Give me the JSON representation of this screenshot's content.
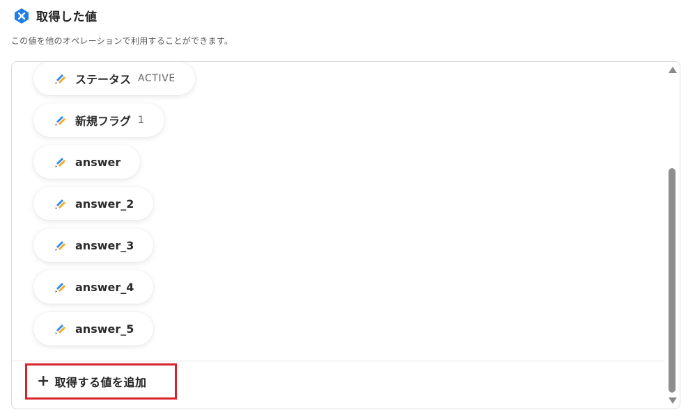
{
  "header": {
    "title": "取得した値",
    "subtitle": "この値を他のオペレーションで利用することができます。",
    "logo_icon": "x-hexagon-icon"
  },
  "fields": [
    {
      "label": "ステータス",
      "value": "ACTIVE",
      "icon": "pencil-stripes-icon"
    },
    {
      "label": "新規フラグ",
      "value": "1",
      "icon": "pencil-stripes-icon"
    },
    {
      "label": "answer",
      "value": "",
      "icon": "pencil-stripes-icon"
    },
    {
      "label": "answer_2",
      "value": "",
      "icon": "pencil-stripes-icon"
    },
    {
      "label": "answer_3",
      "value": "",
      "icon": "pencil-stripes-icon"
    },
    {
      "label": "answer_4",
      "value": "",
      "icon": "pencil-stripes-icon"
    },
    {
      "label": "answer_5",
      "value": "",
      "icon": "pencil-stripes-icon"
    }
  ],
  "add_button": {
    "label": "取得する値を追加",
    "icon": "plus-icon"
  },
  "colors": {
    "accent_blue": "#1f7ee8",
    "icon_orange": "#f5a623",
    "icon_blue": "#2a8bf2",
    "highlight_red": "#d9232b"
  }
}
